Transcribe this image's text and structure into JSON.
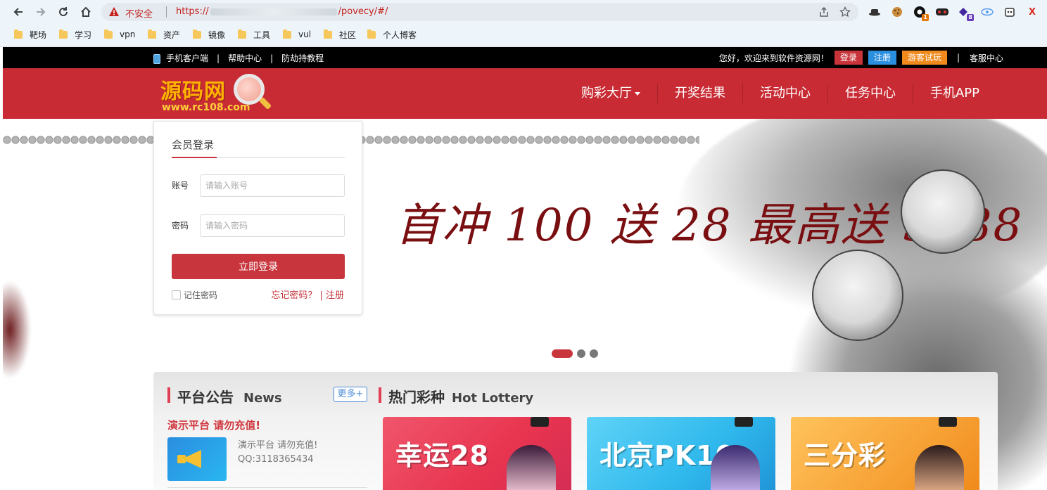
{
  "browser": {
    "insecure_label": "不安全",
    "url_prefix": "https://",
    "url_suffix": "/povecy/#/",
    "extension_badges": [
      "1",
      "8"
    ],
    "close_glyph": "X"
  },
  "bookmarks": [
    "靶场",
    "学习",
    "vpn",
    "资产",
    "镜像",
    "工具",
    "vul",
    "社区",
    "个人博客"
  ],
  "topbar": {
    "links": [
      "手机客户端",
      "帮助中心",
      "防劫持教程"
    ],
    "separator": "|",
    "welcome": "您好，欢迎来到软件资源网！",
    "login": "登录",
    "register": "注册",
    "guest": "游客试玩",
    "service": "客服中心"
  },
  "header": {
    "logo_main": "源码网",
    "logo_sub": "www.rc108.com",
    "menu": [
      "购彩大厅",
      "开奖结果",
      "活动中心",
      "任务中心",
      "手机APP"
    ]
  },
  "banner": {
    "slogan": "首冲 100 送 28 最高送  5888",
    "slide_count": 3,
    "active_slide": 1
  },
  "login": {
    "title": "会员登录",
    "account_label": "账号",
    "account_placeholder": "请输入账号",
    "password_label": "密码",
    "password_placeholder": "请输入密码",
    "submit": "立即登录",
    "remember": "记住密码",
    "forgot": "忘记密码？ | 注册"
  },
  "news": {
    "title_cn": "平台公告",
    "title_en": "News",
    "more": "更多+",
    "headline": "演示平台 请勿充值!",
    "body": "演示平台 请勿充值!",
    "qq": "QQ:3118365434"
  },
  "lottery": {
    "title_cn": "热门彩种",
    "title_en": "Hot Lottery",
    "cards": [
      {
        "name": "幸运28",
        "color": "#e8344f"
      },
      {
        "name": "北京PK10",
        "color": "#2fb8ec"
      },
      {
        "name": "三分彩",
        "color": "#f7a236"
      }
    ]
  },
  "colors": {
    "brand_red": "#c82b33",
    "topbar": "#000000",
    "accent": "#c8353d"
  }
}
